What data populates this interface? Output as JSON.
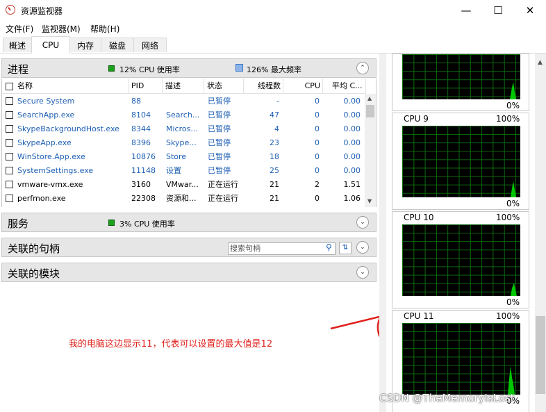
{
  "window": {
    "title": "资源监视器",
    "icon": "resource-monitor-icon"
  },
  "menu": [
    "文件(F)",
    "监视器(M)",
    "帮助(H)"
  ],
  "tabs": [
    "概述",
    "CPU",
    "内存",
    "磁盘",
    "网络"
  ],
  "active_tab": "CPU",
  "processes": {
    "title": "进程",
    "cpu_usage": "12% CPU 使用率",
    "max_freq": "126% 最大频率",
    "columns": [
      "名称",
      "PID",
      "描述",
      "状态",
      "线程数",
      "CPU",
      "平均 C..."
    ],
    "rows": [
      {
        "name": "Secure System",
        "pid": "88",
        "desc": "",
        "status": "已暂停",
        "threads": "-",
        "cpu": "0",
        "avg": "0.00",
        "suspended": true
      },
      {
        "name": "SearchApp.exe",
        "pid": "8104",
        "desc": "Search...",
        "status": "已暂停",
        "threads": "47",
        "cpu": "0",
        "avg": "0.00",
        "suspended": true
      },
      {
        "name": "SkypeBackgroundHost.exe",
        "pid": "8344",
        "desc": "Micros...",
        "status": "已暂停",
        "threads": "4",
        "cpu": "0",
        "avg": "0.00",
        "suspended": true
      },
      {
        "name": "SkypeApp.exe",
        "pid": "8396",
        "desc": "Skype...",
        "status": "已暂停",
        "threads": "23",
        "cpu": "0",
        "avg": "0.00",
        "suspended": true
      },
      {
        "name": "WinStore.App.exe",
        "pid": "10876",
        "desc": "Store",
        "status": "已暂停",
        "threads": "18",
        "cpu": "0",
        "avg": "0.00",
        "suspended": true
      },
      {
        "name": "SystemSettings.exe",
        "pid": "11148",
        "desc": "设置",
        "status": "已暂停",
        "threads": "25",
        "cpu": "0",
        "avg": "0.00",
        "suspended": true
      },
      {
        "name": "vmware-vmx.exe",
        "pid": "3160",
        "desc": "VMwar...",
        "status": "正在运行",
        "threads": "21",
        "cpu": "2",
        "avg": "1.51",
        "suspended": false
      },
      {
        "name": "perfmon.exe",
        "pid": "22308",
        "desc": "资源和...",
        "status": "正在运行",
        "threads": "21",
        "cpu": "0",
        "avg": "1.06",
        "suspended": false
      }
    ]
  },
  "services": {
    "title": "服务",
    "cpu_usage": "3% CPU 使用率"
  },
  "handles": {
    "title": "关联的句柄",
    "search_placeholder": "搜索句柄"
  },
  "modules": {
    "title": "关联的模块"
  },
  "annotation": "我的电脑这边显示11，代表可以设置的最大值是12",
  "cpu_graphs": {
    "top_partial": {
      "min_label": "0%"
    },
    "items": [
      {
        "label": "CPU 9",
        "max_label": "100%",
        "min_label": "0%"
      },
      {
        "label": "CPU 10",
        "max_label": "100%",
        "min_label": "0%"
      },
      {
        "label": "CPU 11",
        "max_label": "100%",
        "min_label": "0%"
      }
    ]
  },
  "watermark": "CSDN @TheMemoryIsLost",
  "colors": {
    "accent_red": "#e0211d",
    "link_blue": "#1e5fb4",
    "graph_green": "#00c800",
    "cpu_swatch": "#1aa01a",
    "freq_swatch": "#8cb4e8"
  }
}
